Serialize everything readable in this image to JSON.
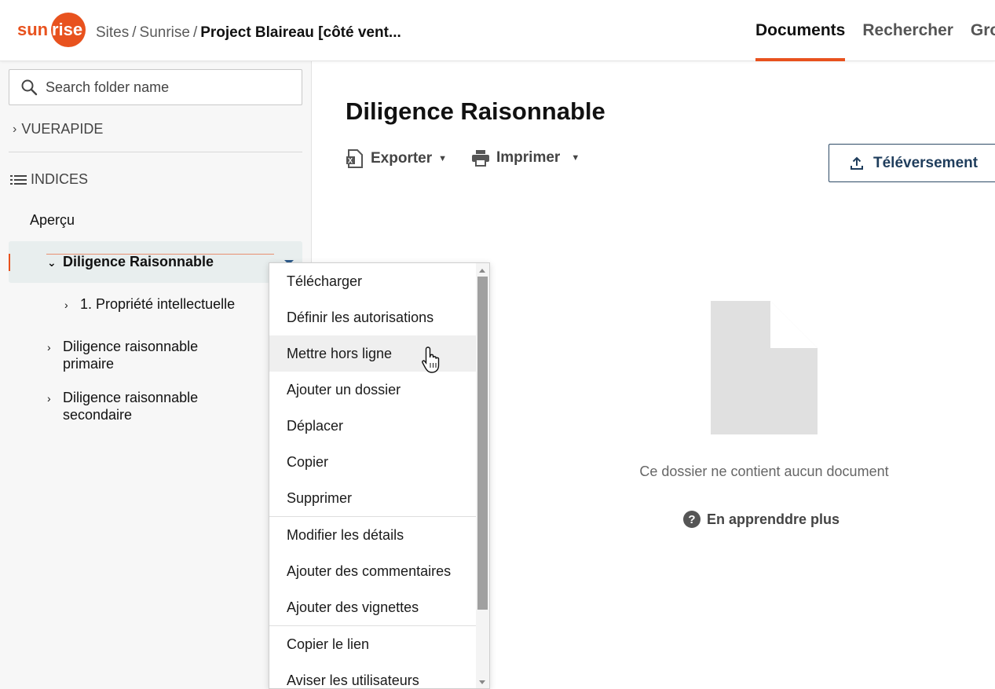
{
  "header": {
    "logo_text_dark": "sun",
    "logo_text_light": "rise",
    "breadcrumb": {
      "site_link": "Sites",
      "separator": "/",
      "parent_link": "Sunrise",
      "current": "Project Blaireau [côté vent..."
    },
    "nav": [
      {
        "label": "Documents",
        "active": true
      },
      {
        "label": "Rechercher",
        "active": false
      },
      {
        "label": "Gro",
        "active": false
      }
    ]
  },
  "sidebar": {
    "search_placeholder": "Search folder name",
    "quickview_label": "VUERAPIDE",
    "indices_label": "INDICES",
    "overview_label": "Aperçu",
    "tree": [
      {
        "label": "Diligence Raisonnable",
        "expanded": true,
        "selected": true
      },
      {
        "label": "1. Propriété intellectuelle",
        "expanded": false
      },
      {
        "label_line1": "Diligence raisonnable",
        "label_line2": "primaire",
        "expanded": false
      },
      {
        "label_line1": "Diligence raisonnable",
        "label_line2": "secondaire",
        "expanded": false
      }
    ]
  },
  "main": {
    "title": "Diligence Raisonnable",
    "export_label": "Exporter",
    "print_label": "Imprimer",
    "upload_label": "Téléversement",
    "empty_message": "Ce dossier ne contient aucun document",
    "learn_more_label": "En apprenddre plus"
  },
  "context_menu": {
    "items": [
      {
        "label": "Télécharger"
      },
      {
        "label": "Définir les autorisations"
      },
      {
        "label": "Mettre hors ligne",
        "hovered": true
      },
      {
        "label": "Ajouter un dossier"
      },
      {
        "label": "Déplacer"
      },
      {
        "label": "Copier"
      },
      {
        "label": "Supprimer"
      },
      {
        "label": "Modifier les détails"
      },
      {
        "label": "Ajouter des commentaires"
      },
      {
        "label": "Ajouter des vignettes"
      },
      {
        "label": "Copier le lien"
      },
      {
        "label": "Aviser les utilisateurs"
      }
    ]
  },
  "colors": {
    "brand_orange": "#e8521e",
    "selected_row": "#e8eeee",
    "upload_border": "#2d4a66"
  }
}
